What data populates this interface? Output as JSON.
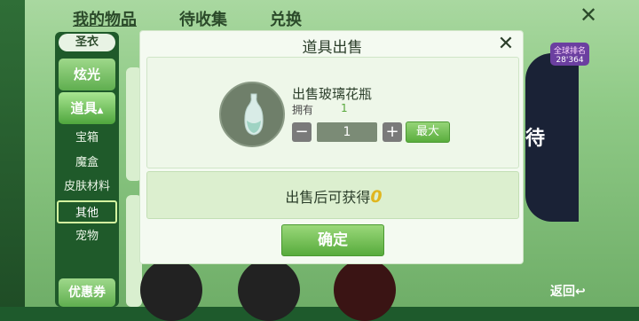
{
  "top_tabs": [
    "我的物品",
    "待收集",
    "兑换"
  ],
  "sidebar": {
    "top_label": "圣衣",
    "items": [
      "炫光",
      "道具"
    ],
    "sub_items": [
      "宝箱",
      "魔盒",
      "皮肤材料",
      "其他",
      "宠物"
    ],
    "bottom_label": "优惠券"
  },
  "badge": {
    "line1": "全球排名",
    "line2": "28'364"
  },
  "right_char": "待",
  "back_label": "返回",
  "dialog": {
    "title": "道具出售",
    "item_name": "出售玻璃花瓶",
    "own_label": "拥有",
    "own_value": "1",
    "minus": "−",
    "plus": "+",
    "quantity": "1",
    "max_label": "最大",
    "gain_label": "出售后可获得",
    "gain_value": "0",
    "confirm_label": "确定"
  },
  "icons": [
    "close-icon",
    "minus-icon",
    "plus-icon",
    "vase-icon"
  ]
}
